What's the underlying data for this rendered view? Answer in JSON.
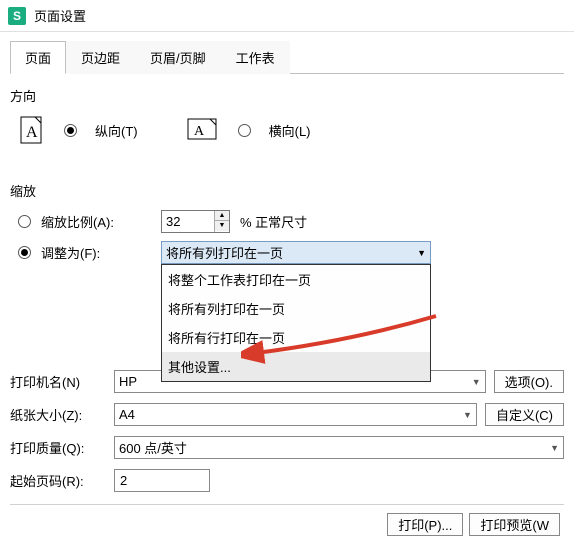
{
  "title": "页面设置",
  "tabs": {
    "page": "页面",
    "margins": "页边距",
    "headerFooter": "页眉/页脚",
    "sheet": "工作表"
  },
  "orientation": {
    "label": "方向",
    "portrait": "纵向(T)",
    "landscape": "横向(L)"
  },
  "scaling": {
    "label": "缩放",
    "ratioLabel": "缩放比例(A):",
    "ratioValue": "32",
    "ratioSuffix": "% 正常尺寸",
    "fitLabel": "调整为(F):",
    "fitSelected": "将所有列打印在一页",
    "options": [
      "将整个工作表打印在一页",
      "将所有列打印在一页",
      "将所有行打印在一页",
      "其他设置..."
    ],
    "highlightIndex": 3
  },
  "printer": {
    "label": "打印机名(N)",
    "value": "HP",
    "optionsBtn": "选项(O)."
  },
  "paper": {
    "label": "纸张大小(Z):",
    "value": "A4",
    "customBtn": "自定义(C)"
  },
  "quality": {
    "label": "打印质量(Q):",
    "value": "600 点/英寸"
  },
  "startPage": {
    "label": "起始页码(R):",
    "value": "2"
  },
  "footer": {
    "print": "打印(P)...",
    "preview": "打印预览(W"
  }
}
